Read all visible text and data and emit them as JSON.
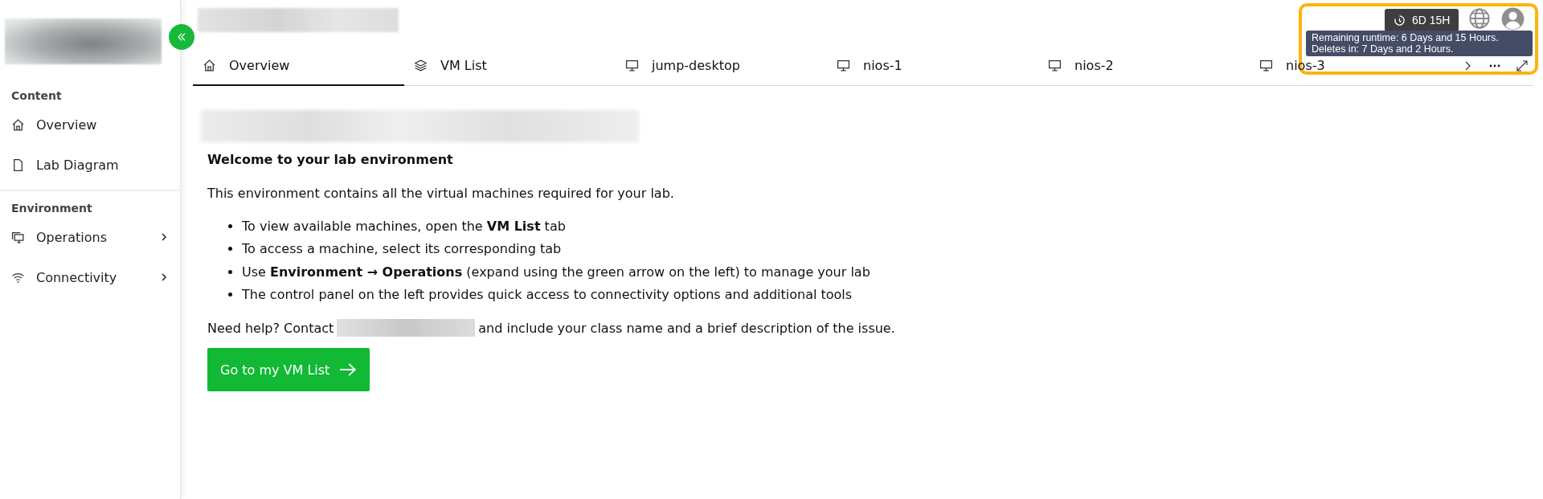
{
  "sidebar": {
    "sections": [
      {
        "title": "Content",
        "items": [
          {
            "label": "Overview",
            "kind": "home",
            "expandable": false
          },
          {
            "label": "Lab Diagram",
            "kind": "file",
            "expandable": false
          }
        ]
      },
      {
        "title": "Environment",
        "items": [
          {
            "label": "Operations",
            "kind": "screens",
            "expandable": true
          },
          {
            "label": "Connectivity",
            "kind": "wifi",
            "expandable": true
          }
        ]
      }
    ]
  },
  "tabs": [
    {
      "label": "Overview",
      "kind": "home",
      "selected": true
    },
    {
      "label": "VM List",
      "kind": "layers",
      "selected": false
    },
    {
      "label": "jump-desktop",
      "kind": "monitor",
      "selected": false
    },
    {
      "label": "nios-1",
      "kind": "monitor",
      "selected": false
    },
    {
      "label": "nios-2",
      "kind": "monitor",
      "selected": false
    },
    {
      "label": "nios-3",
      "kind": "monitor",
      "selected": false
    }
  ],
  "header": {
    "runtime_badge": "6D 15H",
    "tooltip": [
      "Remaining runtime: 6 Days and 15 Hours.",
      "Deletes in: 7 Days and 2 Hours."
    ]
  },
  "content": {
    "heading": "Welcome to your lab environment",
    "intro": "This environment contains all the virtual machines required for your lab.",
    "bullets": [
      "To view available machines, open the **VM List** tab",
      "To access a machine, select its corresponding tab",
      "Use **Environment → Operations** (expand using the green arrow on the left) to manage your lab",
      "The control panel on the left provides quick access to connectivity options and additional tools"
    ],
    "help_before": "Need help? Contact",
    "help_after": "and include your class name and a brief description of the issue.",
    "button": "Go to my VM List"
  }
}
